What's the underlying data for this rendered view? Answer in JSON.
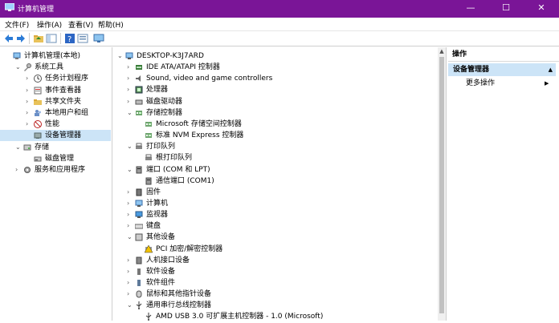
{
  "window": {
    "title": "计算机管理",
    "min": "—",
    "max": "☐",
    "close": "✕"
  },
  "menu": [
    "文件(F)",
    "操作(A)",
    "查看(V)",
    "帮助(H)"
  ],
  "toolbar_icons": [
    "back-arrow-icon",
    "forward-arrow-icon",
    "folder-up-icon",
    "show-hide-tree-icon",
    "help-icon",
    "properties-icon",
    "monitor-icon"
  ],
  "left_tree": [
    {
      "label": "计算机管理(本地)",
      "level": 0,
      "expander": "",
      "icon": "computer-management-icon"
    },
    {
      "label": "系统工具",
      "level": 1,
      "expander": "v",
      "icon": "tools-icon"
    },
    {
      "label": "任务计划程序",
      "level": 2,
      "expander": ">",
      "icon": "clock-icon"
    },
    {
      "label": "事件查看器",
      "level": 2,
      "expander": ">",
      "icon": "event-viewer-icon"
    },
    {
      "label": "共享文件夹",
      "level": 2,
      "expander": ">",
      "icon": "shared-folder-icon"
    },
    {
      "label": "本地用户和组",
      "level": 2,
      "expander": ">",
      "icon": "users-icon"
    },
    {
      "label": "性能",
      "level": 2,
      "expander": ">",
      "icon": "performance-icon"
    },
    {
      "label": "设备管理器",
      "level": 2,
      "expander": "",
      "icon": "device-manager-icon",
      "selected": true
    },
    {
      "label": "存储",
      "level": 1,
      "expander": "v",
      "icon": "storage-icon"
    },
    {
      "label": "磁盘管理",
      "level": 2,
      "expander": "",
      "icon": "disk-icon"
    },
    {
      "label": "服务和应用程序",
      "level": 1,
      "expander": ">",
      "icon": "services-icon"
    }
  ],
  "device_tree": [
    {
      "label": "DESKTOP-K3J7ARD",
      "level": 0,
      "expander": "v",
      "icon": "computer-icon"
    },
    {
      "label": "IDE ATA/ATAPI 控制器",
      "level": 1,
      "expander": ">",
      "icon": "ide-controller-icon"
    },
    {
      "label": "Sound, video and game controllers",
      "level": 1,
      "expander": ">",
      "icon": "speaker-icon"
    },
    {
      "label": "处理器",
      "level": 1,
      "expander": ">",
      "icon": "processor-icon"
    },
    {
      "label": "磁盘驱动器",
      "level": 1,
      "expander": ">",
      "icon": "disk-drive-icon"
    },
    {
      "label": "存储控制器",
      "level": 1,
      "expander": "v",
      "icon": "storage-controller-icon"
    },
    {
      "label": "Microsoft 存储空间控制器",
      "level": 2,
      "expander": "",
      "icon": "storage-controller-icon"
    },
    {
      "label": "标准 NVM Express 控制器",
      "level": 2,
      "expander": "",
      "icon": "storage-controller-icon"
    },
    {
      "label": "打印队列",
      "level": 1,
      "expander": "v",
      "icon": "printer-icon"
    },
    {
      "label": "根打印队列",
      "level": 2,
      "expander": "",
      "icon": "printer-icon"
    },
    {
      "label": "端口 (COM 和 LPT)",
      "level": 1,
      "expander": "v",
      "icon": "port-icon"
    },
    {
      "label": "通信端口 (COM1)",
      "level": 2,
      "expander": "",
      "icon": "port-icon"
    },
    {
      "label": "固件",
      "level": 1,
      "expander": ">",
      "icon": "firmware-icon"
    },
    {
      "label": "计算机",
      "level": 1,
      "expander": ">",
      "icon": "computer-icon"
    },
    {
      "label": "监视器",
      "level": 1,
      "expander": ">",
      "icon": "monitor-icon"
    },
    {
      "label": "键盘",
      "level": 1,
      "expander": ">",
      "icon": "keyboard-icon"
    },
    {
      "label": "其他设备",
      "level": 1,
      "expander": "v",
      "icon": "other-device-icon"
    },
    {
      "label": "PCI 加密/解密控制器",
      "level": 2,
      "expander": "",
      "icon": "warning-device-icon"
    },
    {
      "label": "人机接口设备",
      "level": 1,
      "expander": ">",
      "icon": "hid-icon"
    },
    {
      "label": "软件设备",
      "level": 1,
      "expander": ">",
      "icon": "software-device-icon"
    },
    {
      "label": "软件组件",
      "level": 1,
      "expander": ">",
      "icon": "software-component-icon"
    },
    {
      "label": "鼠标和其他指针设备",
      "level": 1,
      "expander": ">",
      "icon": "mouse-icon"
    },
    {
      "label": "通用串行总线控制器",
      "level": 1,
      "expander": "v",
      "icon": "usb-icon"
    },
    {
      "label": "AMD USB 3.0 可扩展主机控制器 - 1.0 (Microsoft)",
      "level": 2,
      "expander": "",
      "icon": "usb-icon"
    }
  ],
  "actions": {
    "header": "操作",
    "selected": "设备管理器",
    "more": "更多操作"
  },
  "colors": {
    "titlebar": "#7a1597",
    "selection": "#cce4f7"
  }
}
